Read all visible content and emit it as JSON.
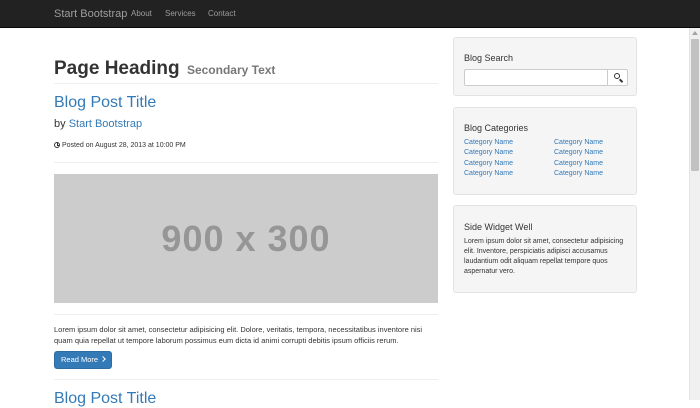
{
  "navbar": {
    "brand": "Start Bootstrap",
    "links": [
      "About",
      "Services",
      "Contact"
    ]
  },
  "page": {
    "heading": "Page Heading",
    "secondary": "Secondary Text"
  },
  "posts": [
    {
      "title": "Blog Post Title",
      "by_prefix": "by",
      "author": "Start Bootstrap",
      "posted": "Posted on August 28, 2013 at 10:00 PM",
      "image_text": "900 x 300",
      "body": "Lorem ipsum dolor sit amet, consectetur adipisicing elit. Dolore, veritatis, tempora, necessitatibus inventore nisi quam quia repellat ut tempore laborum possimus eum dicta id animi corrupti debitis ipsum officiis rerum.",
      "read_more": "Read More"
    },
    {
      "title": "Blog Post Title"
    }
  ],
  "sidebar": {
    "search": {
      "title": "Blog Search",
      "value": ""
    },
    "categories": {
      "title": "Blog Categories",
      "left": [
        "Category Name",
        "Category Name",
        "Category Name",
        "Category Name"
      ],
      "right": [
        "Category Name",
        "Category Name",
        "Category Name",
        "Category Name"
      ]
    },
    "widget": {
      "title": "Side Widget Well",
      "text": "Lorem ipsum dolor sit amet, consectetur adipisicing elit. Inventore, perspiciatis adipisci accusamus laudantium odit aliquam repellat tempore quos aspernatur vero."
    }
  },
  "colors": {
    "navbar_bg": "#222222",
    "link": "#337ab7",
    "button": "#337ab7",
    "placeholder": "#cccccc",
    "well_bg": "#f5f5f5"
  }
}
